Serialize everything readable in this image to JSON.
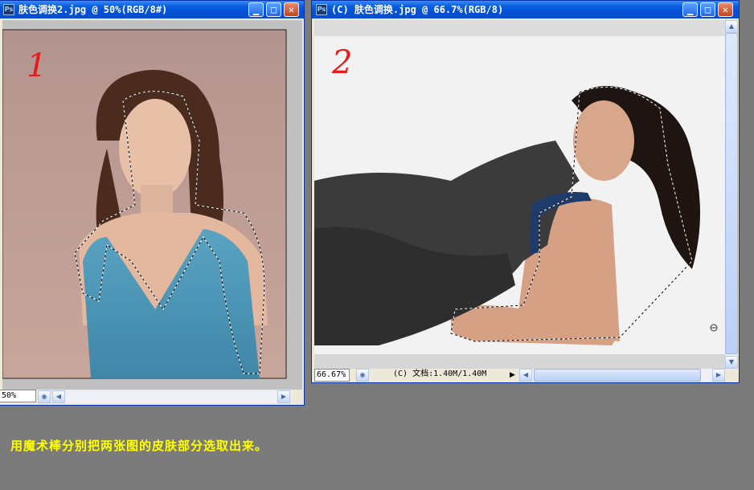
{
  "window1": {
    "title": "肤色调换2.jpg @ 50%(RGB/8#)",
    "ps_icon": "Ps",
    "marker": "1",
    "zoom": "50%"
  },
  "window2": {
    "title": "(C) 肤色调换.jpg @ 66.7%(RGB/8)",
    "ps_icon": "Ps",
    "marker": "2",
    "zoom": "66.67%",
    "doc_info": "(C) 文档:1.40M/1.40M"
  },
  "caption": "用魔术棒分别把两张图的皮肤部分选取出来。",
  "colors": {
    "caption": "#ffff00",
    "marker": "#e81a1a",
    "titlebar": "#0a5fe0"
  }
}
